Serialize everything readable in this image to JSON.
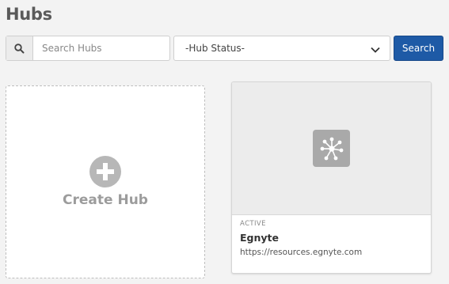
{
  "page": {
    "title": "Hubs"
  },
  "toolbar": {
    "search_placeholder": "Search Hubs",
    "search_value": "",
    "status_selected": "-Hub Status-",
    "search_button_label": "Search"
  },
  "create_card": {
    "label": "Create Hub"
  },
  "hubs": [
    {
      "status": "ACTIVE",
      "name": "Egnyte",
      "url": "https://resources.egnyte.com"
    }
  ],
  "colors": {
    "accent": "#1e5aa6",
    "background": "#f3f3f3"
  }
}
